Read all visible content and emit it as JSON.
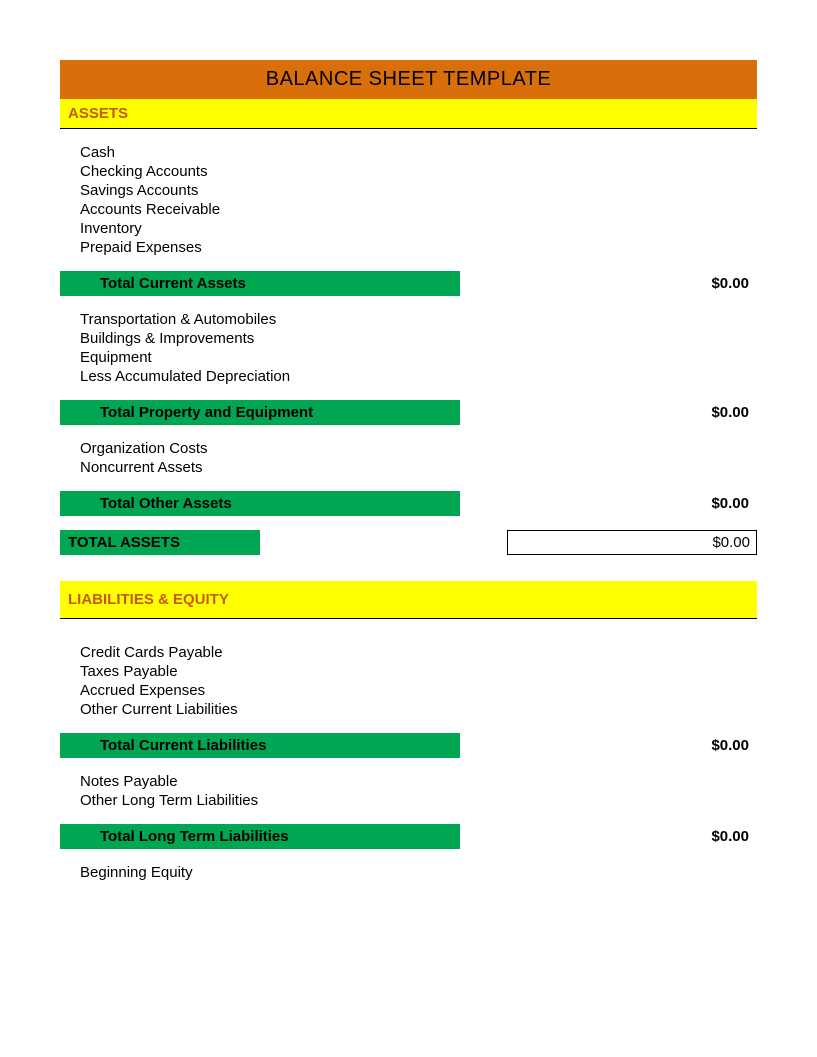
{
  "title": "BALANCE SHEET TEMPLATE",
  "sections": {
    "assets": {
      "header": "ASSETS",
      "current_items": [
        "Cash",
        "Checking Accounts",
        "Savings Accounts",
        "Accounts Receivable",
        "Inventory",
        "Prepaid Expenses"
      ],
      "current_total_label": "Total Current Assets",
      "current_total_value": "$0.00",
      "property_items": [
        "Transportation & Automobiles",
        "Buildings & Improvements",
        "Equipment",
        "Less Accumulated Depreciation"
      ],
      "property_total_label": "Total Property and Equipment",
      "property_total_value": "$0.00",
      "other_items": [
        "Organization Costs",
        "Noncurrent Assets"
      ],
      "other_total_label": "Total Other Assets",
      "other_total_value": "$0.00",
      "grand_label": "TOTAL ASSETS",
      "grand_value": "$0.00"
    },
    "liabilities": {
      "header": "LIABILITIES & EQUITY",
      "current_items": [
        "Credit Cards Payable",
        "Taxes Payable",
        "Accrued Expenses",
        "Other Current Liabilities"
      ],
      "current_total_label": "Total Current Liabilities",
      "current_total_value": "$0.00",
      "longterm_items": [
        "Notes Payable",
        "Other Long Term Liabilities"
      ],
      "longterm_total_label": "Total Long Term Liabilities",
      "longterm_total_value": "$0.00",
      "equity_items": [
        "Beginning Equity"
      ]
    }
  }
}
